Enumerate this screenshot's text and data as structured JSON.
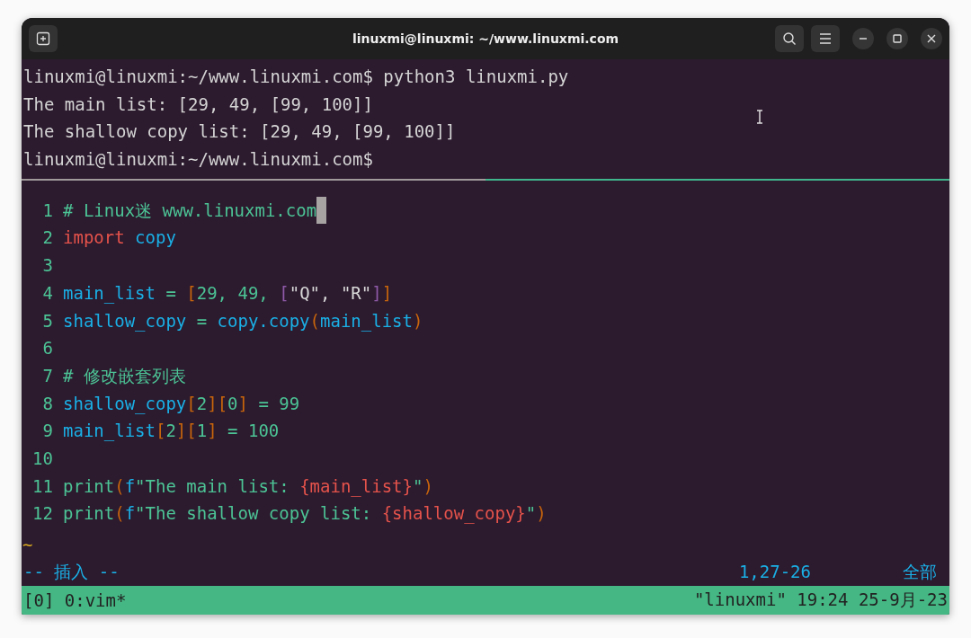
{
  "window": {
    "title": "linuxmi@linuxmi: ~/www.linuxmi.com"
  },
  "shell_output": [
    "linuxmi@linuxmi:~/www.linuxmi.com$ python3 linuxmi.py",
    "The main list: [29, 49, [99, 100]]",
    "The shallow copy list: [29, 49, [99, 100]]",
    "linuxmi@linuxmi:~/www.linuxmi.com$"
  ],
  "editor": {
    "lines": [
      {
        "number": "1",
        "cursor": true,
        "tokens": [
          {
            "kind": "comment",
            "text": "# Linux迷 www.linuxmi.com"
          }
        ]
      },
      {
        "number": "2",
        "cursor": false,
        "tokens": [
          {
            "kind": "keyword",
            "text": "import"
          },
          {
            "kind": "name",
            "text": " copy"
          }
        ]
      },
      {
        "number": "3",
        "cursor": false
      },
      {
        "number": "4",
        "cursor": false,
        "tokens": [
          {
            "kind": "name",
            "text": "main_list"
          },
          {
            "kind": "op",
            "text": " = "
          },
          {
            "kind": "bracket",
            "text": "["
          },
          {
            "kind": "op",
            "text": "29, 49, "
          },
          {
            "kind": "bracket2",
            "text": "["
          },
          {
            "kind": "string",
            "text": "\"Q\", \"R\""
          },
          {
            "kind": "bracket2",
            "text": "]"
          },
          {
            "kind": "bracket",
            "text": "]"
          }
        ]
      },
      {
        "number": "5",
        "cursor": false,
        "tokens": [
          {
            "kind": "name",
            "text": "shallow_copy"
          },
          {
            "kind": "op",
            "text": " = "
          },
          {
            "kind": "name",
            "text": "copy.copy"
          },
          {
            "kind": "bracket",
            "text": "("
          },
          {
            "kind": "name",
            "text": "main_list"
          },
          {
            "kind": "bracket",
            "text": ")"
          }
        ]
      },
      {
        "number": "6",
        "cursor": false
      },
      {
        "number": "7",
        "cursor": false,
        "tokens": [
          {
            "kind": "comment",
            "text": "# 修改嵌套列表"
          }
        ]
      },
      {
        "number": "8",
        "cursor": false,
        "tokens": [
          {
            "kind": "name",
            "text": "shallow_copy"
          },
          {
            "kind": "bracket",
            "text": "["
          },
          {
            "kind": "op",
            "text": "2"
          },
          {
            "kind": "bracket",
            "text": "]["
          },
          {
            "kind": "op",
            "text": "0"
          },
          {
            "kind": "bracket",
            "text": "]"
          },
          {
            "kind": "op",
            "text": " = 99"
          }
        ]
      },
      {
        "number": "9",
        "cursor": false,
        "tokens": [
          {
            "kind": "name",
            "text": "main_list"
          },
          {
            "kind": "bracket",
            "text": "["
          },
          {
            "kind": "op",
            "text": "2"
          },
          {
            "kind": "bracket",
            "text": "]["
          },
          {
            "kind": "op",
            "text": "1"
          },
          {
            "kind": "bracket",
            "text": "]"
          },
          {
            "kind": "op",
            "text": " = 100"
          }
        ]
      },
      {
        "number": "10",
        "cursor": false
      },
      {
        "number": "11",
        "cursor": false,
        "tokens": [
          {
            "kind": "op",
            "text": "print"
          },
          {
            "kind": "bracket",
            "text": "("
          },
          {
            "kind": "name",
            "text": "f"
          },
          {
            "kind": "op",
            "text": "\"The main list: "
          },
          {
            "kind": "keyword",
            "text": "{main_list}"
          },
          {
            "kind": "op",
            "text": "\""
          },
          {
            "kind": "bracket",
            "text": ")"
          }
        ]
      },
      {
        "number": "12",
        "cursor": false,
        "tokens": [
          {
            "kind": "op",
            "text": "print"
          },
          {
            "kind": "bracket",
            "text": "("
          },
          {
            "kind": "name",
            "text": "f"
          },
          {
            "kind": "op",
            "text": "\"The shallow copy list: "
          },
          {
            "kind": "keyword",
            "text": "{shallow_copy}"
          },
          {
            "kind": "op",
            "text": "\""
          },
          {
            "kind": "bracket",
            "text": ")"
          }
        ]
      }
    ],
    "tilde": "~",
    "mode": "-- 插入 --",
    "position": "1,27-26",
    "scroll": "全部"
  },
  "status_bar": {
    "left": "[0] 0:vim*",
    "right": "\"linuxmi\" 19:24 25-9月-23"
  }
}
